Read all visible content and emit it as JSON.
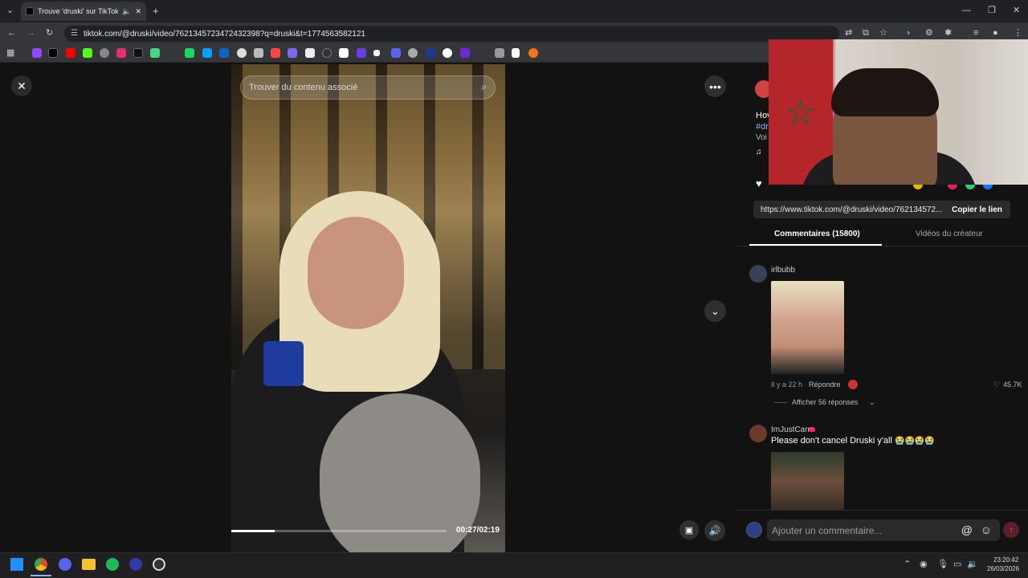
{
  "browser": {
    "tab_title": "Trouve 'druski' sur TikTok | R",
    "url": "tiktok.com/@druski/video/7621345723472432398?q=druski&t=1774563582121"
  },
  "video": {
    "search_placeholder": "Trouver du contenu associé",
    "time": "00:27/02:19",
    "progress_fraction": 0.2
  },
  "panel": {
    "link": "https://www.tiktok.com/@druski/video/762134572...",
    "copy_label": "Copier le lien",
    "tab_comments": "Commentaires (15800)",
    "tab_creator": "Vidéos du créateur",
    "partial_text": {
      "line1": "Hov",
      "line2": "#dr",
      "line3": "Voi"
    }
  },
  "comments": [
    {
      "user": "irlbubb",
      "time": "Il y a 22 h",
      "reply": "Répondre",
      "likes": "45.7K",
      "replies": "Afficher 56 réponses"
    },
    {
      "user": "ImJustCarr",
      "text": "Please don't cancel Druski y'all"
    }
  ],
  "comment_input": {
    "placeholder": "Ajouter un commentaire..."
  },
  "taskbar": {
    "time": "23:20:42",
    "date": "26/03/2026"
  },
  "colors": {
    "accent_red": "#fe2c55"
  }
}
